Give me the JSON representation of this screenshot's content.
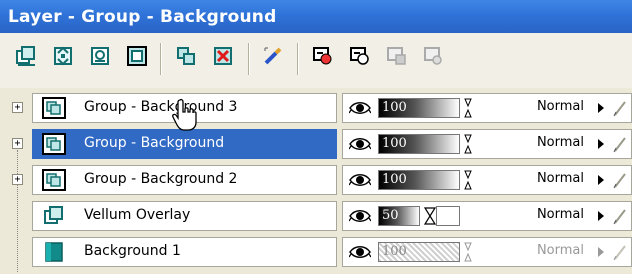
{
  "window": {
    "title": "Layer - Group - Background"
  },
  "toolbar": {
    "buttons": [
      "new-raster-layer-icon",
      "new-vector-layer-icon",
      "new-art-media-layer-icon",
      "new-mask-layer-icon",
      "duplicate-layer-icon",
      "delete-layer-icon",
      "edit-selection-icon",
      "link-layers-icon",
      "unlink-layers-icon",
      "lock-layer-icon",
      "unlock-layer-icon"
    ]
  },
  "layers": [
    {
      "name": "Group - Background 3",
      "opacity": "100",
      "blend": "Normal",
      "expandable": true,
      "expander": "+",
      "selected": false,
      "dim": false
    },
    {
      "name": "Group - Background",
      "opacity": "100",
      "blend": "Normal",
      "expandable": true,
      "expander": "+",
      "selected": true,
      "dim": false
    },
    {
      "name": "Group - Background 2",
      "opacity": "100",
      "blend": "Normal",
      "expandable": true,
      "expander": "+",
      "selected": false,
      "dim": false
    },
    {
      "name": "Vellum Overlay",
      "opacity": "50",
      "blend": "Normal",
      "expandable": false,
      "selected": false,
      "dim": false
    },
    {
      "name": "Background 1",
      "opacity": "100",
      "blend": "Normal",
      "expandable": false,
      "selected": false,
      "dim": true
    }
  ],
  "colors": {
    "title_bar": "#2f73d8",
    "selection": "#316ac5"
  }
}
